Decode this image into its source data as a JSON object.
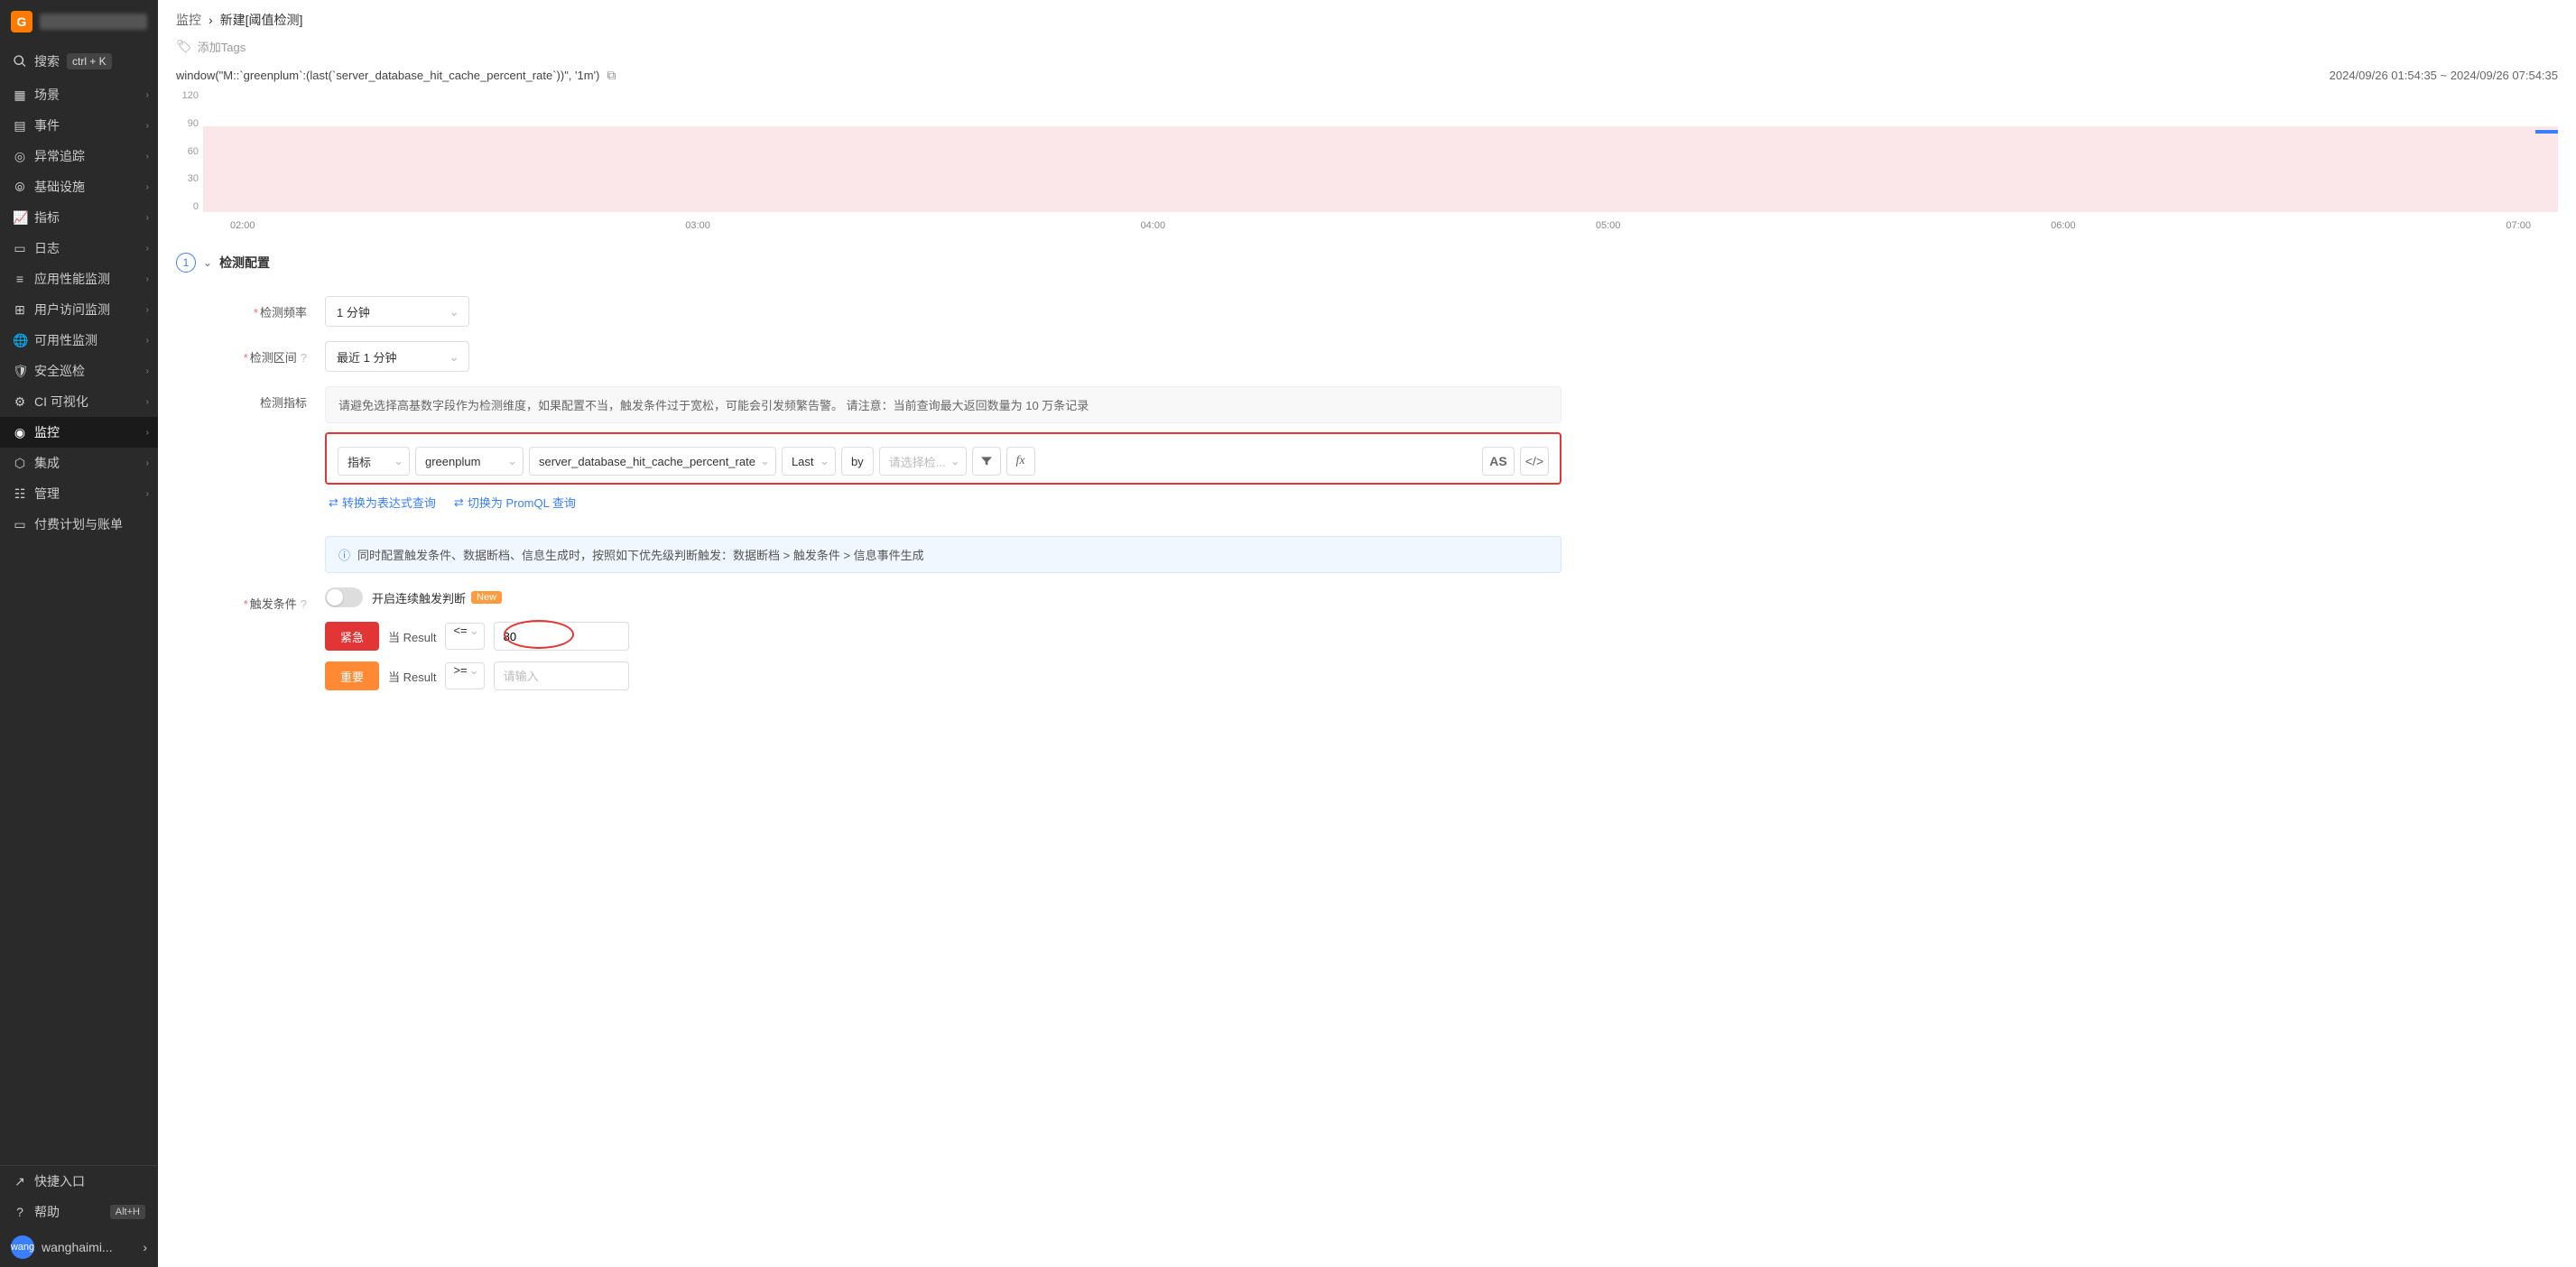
{
  "sidebar": {
    "search_label": "搜索",
    "search_shortcut": "ctrl + K",
    "items": [
      {
        "icon": "scene",
        "label": "场景"
      },
      {
        "icon": "calendar",
        "label": "事件"
      },
      {
        "icon": "trace",
        "label": "异常追踪"
      },
      {
        "icon": "infra",
        "label": "基础设施"
      },
      {
        "icon": "metrics",
        "label": "指标"
      },
      {
        "icon": "logs",
        "label": "日志"
      },
      {
        "icon": "apm",
        "label": "应用性能监测"
      },
      {
        "icon": "rum",
        "label": "用户访问监测"
      },
      {
        "icon": "avail",
        "label": "可用性监测"
      },
      {
        "icon": "security",
        "label": "安全巡检"
      },
      {
        "icon": "ci",
        "label": "CI 可视化"
      },
      {
        "icon": "monitor",
        "label": "监控",
        "active": true
      },
      {
        "icon": "integrate",
        "label": "集成"
      },
      {
        "icon": "manage",
        "label": "管理"
      },
      {
        "icon": "billing",
        "label": "付费计划与账单"
      }
    ],
    "bottom": [
      {
        "icon": "quick",
        "label": "快捷入口"
      },
      {
        "icon": "help",
        "label": "帮助",
        "shortcut": "Alt+H"
      }
    ],
    "user": {
      "avatar": "wang",
      "name": "wanghaimi..."
    }
  },
  "breadcrumb": {
    "root": "监控",
    "current": "新建[阈值检测]"
  },
  "tags": {
    "add_label": "添加Tags"
  },
  "query": "window(\"M::`greenplum`:(last(`server_database_hit_cache_percent_rate`))\", '1m')",
  "timerange": "2024/09/26 01:54:35 ~ 2024/09/26 07:54:35",
  "chart_data": {
    "type": "line",
    "ylim": [
      0,
      120
    ],
    "yticks": [
      0,
      30,
      60,
      90,
      120
    ],
    "xticks": [
      "02:00",
      "03:00",
      "04:00",
      "05:00",
      "06:00",
      "07:00"
    ],
    "threshold_band": {
      "from": 0,
      "to": 90,
      "color": "#fbe7e9"
    },
    "series": []
  },
  "section1": {
    "num": "1",
    "title": "检测配置",
    "freq_label": "检测频率",
    "freq_value": "1 分钟",
    "interval_label": "检测区间",
    "interval_value": "最近 1 分钟",
    "metric_label": "检测指标",
    "metric_hint": "请避免选择高基数字段作为检测维度，如果配置不当，触发条件过于宽松，可能会引发频繁告警。 请注意：当前查询最大返回数量为 10 万条记录",
    "builder": {
      "source": "指标",
      "measurement": "greenplum",
      "field": "server_database_hit_cache_percent_rate",
      "agg": "Last",
      "by_label": "by",
      "by_placeholder": "请选择检...",
      "as_label": "AS"
    },
    "link_expr": "转换为表达式查询",
    "link_promql": "切换为 PromQL 查询"
  },
  "trigger": {
    "info": "同时配置触发条件、数据断档、信息生成时，按照如下优先级判断触发：数据断档 > 触发条件 > 信息事件生成",
    "label": "触发条件",
    "toggle_label": "开启连续触发判断",
    "new_badge": "New",
    "when_label": "当 Result",
    "crit": {
      "badge": "紧急",
      "op": "<=",
      "value": "80"
    },
    "major": {
      "badge": "重要",
      "op": ">=",
      "placeholder": "请输入"
    }
  }
}
